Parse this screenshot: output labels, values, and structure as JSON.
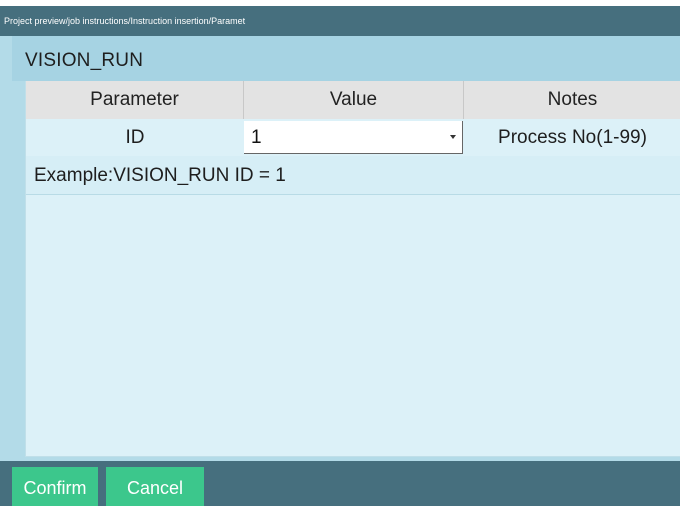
{
  "window": {
    "title": "Project preview/job instructions/Instruction insertion/Paramet"
  },
  "header": {
    "title": "VISION_RUN"
  },
  "table": {
    "columns": [
      "Parameter",
      "Value",
      "Notes"
    ],
    "rows": [
      {
        "parameter": "ID",
        "value": "1",
        "notes": "Process No(1-99)"
      }
    ]
  },
  "example": {
    "text": "Example:VISION_RUN ID = 1"
  },
  "footer": {
    "confirm_label": "Confirm",
    "cancel_label": "Cancel"
  },
  "icons": {
    "value_dropdown": "chevron-down-icon"
  },
  "colors": {
    "titlebar": "#466f7e",
    "panel": "#b3dbe8",
    "content": "#dcf1f8",
    "table_header": "#e3e3e3",
    "button": "#3cc78c"
  }
}
